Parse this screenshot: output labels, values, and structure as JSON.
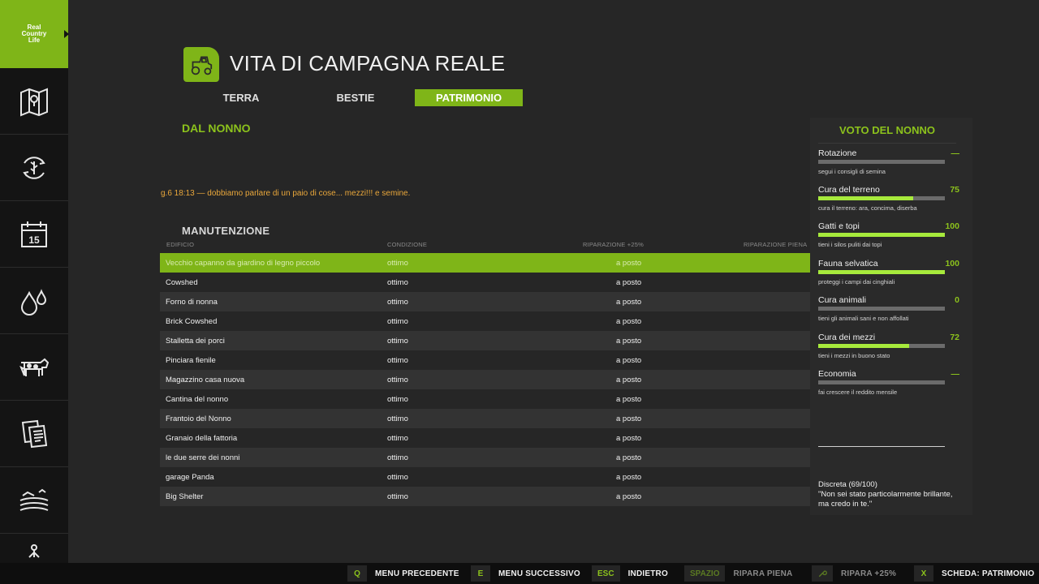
{
  "sidebar": {
    "logo_text": "Real Country Life",
    "items": [
      {
        "icon": "map-icon"
      },
      {
        "icon": "crop-cycle-icon"
      },
      {
        "icon": "calendar-icon",
        "badge": "15"
      },
      {
        "icon": "water-drops-icon"
      },
      {
        "icon": "cow-icon"
      },
      {
        "icon": "documents-icon"
      },
      {
        "icon": "fields-icon"
      },
      {
        "icon": "person-icon"
      }
    ]
  },
  "header": {
    "icon": "tractor-icon",
    "title": "VITA DI CAMPAGNA REALE"
  },
  "tabs": [
    {
      "label": "TERRA",
      "active": false
    },
    {
      "label": "BESTIE",
      "active": false
    },
    {
      "label": "PATRIMONIO",
      "active": true
    }
  ],
  "grandpa_section": {
    "title": "DAL NONNO",
    "message": "g.6  18:13  —  dobbiamo parlare di un paio di cose... mezzi!!! e semine."
  },
  "maintenance": {
    "title": "MANUTENZIONE",
    "columns": [
      "EDIFICIO",
      "CONDIZIONE",
      "RIPARAZIONE +25%",
      "RIPARAZIONE PIENA"
    ],
    "rows": [
      {
        "building": "Vecchio capanno da giardino di legno piccolo",
        "condition": "ottimo",
        "repair25": "a posto",
        "selected": true
      },
      {
        "building": "Cowshed",
        "condition": "ottimo",
        "repair25": "a posto"
      },
      {
        "building": "Forno di nonna",
        "condition": "ottimo",
        "repair25": "a posto"
      },
      {
        "building": "Brick Cowshed",
        "condition": "ottimo",
        "repair25": "a posto"
      },
      {
        "building": "Stalletta dei porci",
        "condition": "ottimo",
        "repair25": "a posto"
      },
      {
        "building": "Pinciara fienile",
        "condition": "ottimo",
        "repair25": "a posto"
      },
      {
        "building": "Magazzino casa nuova",
        "condition": "ottimo",
        "repair25": "a posto"
      },
      {
        "building": "Cantina del nonno",
        "condition": "ottimo",
        "repair25": "a posto"
      },
      {
        "building": "Frantoio del Nonno",
        "condition": "ottimo",
        "repair25": "a posto"
      },
      {
        "building": "Granaio della fattoria",
        "condition": "ottimo",
        "repair25": "a posto"
      },
      {
        "building": "le due serre dei nonni",
        "condition": "ottimo",
        "repair25": "a posto"
      },
      {
        "building": "garage Panda",
        "condition": "ottimo",
        "repair25": "a posto"
      },
      {
        "building": "Big Shelter",
        "condition": "ottimo",
        "repair25": "a posto"
      }
    ]
  },
  "grandpa_rating": {
    "title": "VOTO DEL NONNO",
    "stats": [
      {
        "name": "Rotazione",
        "value": "—",
        "fill": 0,
        "desc": "segui i consigli di semina"
      },
      {
        "name": "Cura del terreno",
        "value": "75",
        "fill": 0.75,
        "desc": "cura il terreno: ara, concima, diserba"
      },
      {
        "name": "Gatti e topi",
        "value": "100",
        "fill": 1.0,
        "desc": "tieni i silos puliti dai topi"
      },
      {
        "name": "Fauna selvatica",
        "value": "100",
        "fill": 1.0,
        "desc": "proteggi i campi dai cinghiali"
      },
      {
        "name": "Cura animali",
        "value": "0",
        "fill": 0,
        "desc": "tieni gli animali sani e non affollati"
      },
      {
        "name": "Cura dei mezzi",
        "value": "72",
        "fill": 0.72,
        "desc": "tieni i mezzi in buono stato"
      },
      {
        "name": "Economia",
        "value": "—",
        "fill": 0,
        "desc": "fai crescere il reddito mensile"
      }
    ],
    "overall_line1": "Discreta (69/100)",
    "overall_line2": "\"Non sei stato particolarmente brillante, ma credo in te.\""
  },
  "bottombar": [
    {
      "key": "Q",
      "label": "MENU PRECEDENTE",
      "disabled": false
    },
    {
      "key": "E",
      "label": "MENU SUCCESSIVO",
      "disabled": false
    },
    {
      "key": "ESC",
      "label": "INDIETRO",
      "disabled": false
    },
    {
      "key": "SPAZIO",
      "label": "RIPARA PIENA",
      "disabled": true
    },
    {
      "key": "",
      "key_icon": "wrench-icon",
      "label": "RIPARA +25%",
      "disabled": true
    },
    {
      "key": "X",
      "label": "SCHEDA: PATRIMONIO",
      "disabled": false
    }
  ],
  "colors": {
    "accent": "#7fb518",
    "accent_text": "#8cc21c",
    "bar_fill": "#a7ea3c",
    "warning_text": "#e9a73b"
  }
}
